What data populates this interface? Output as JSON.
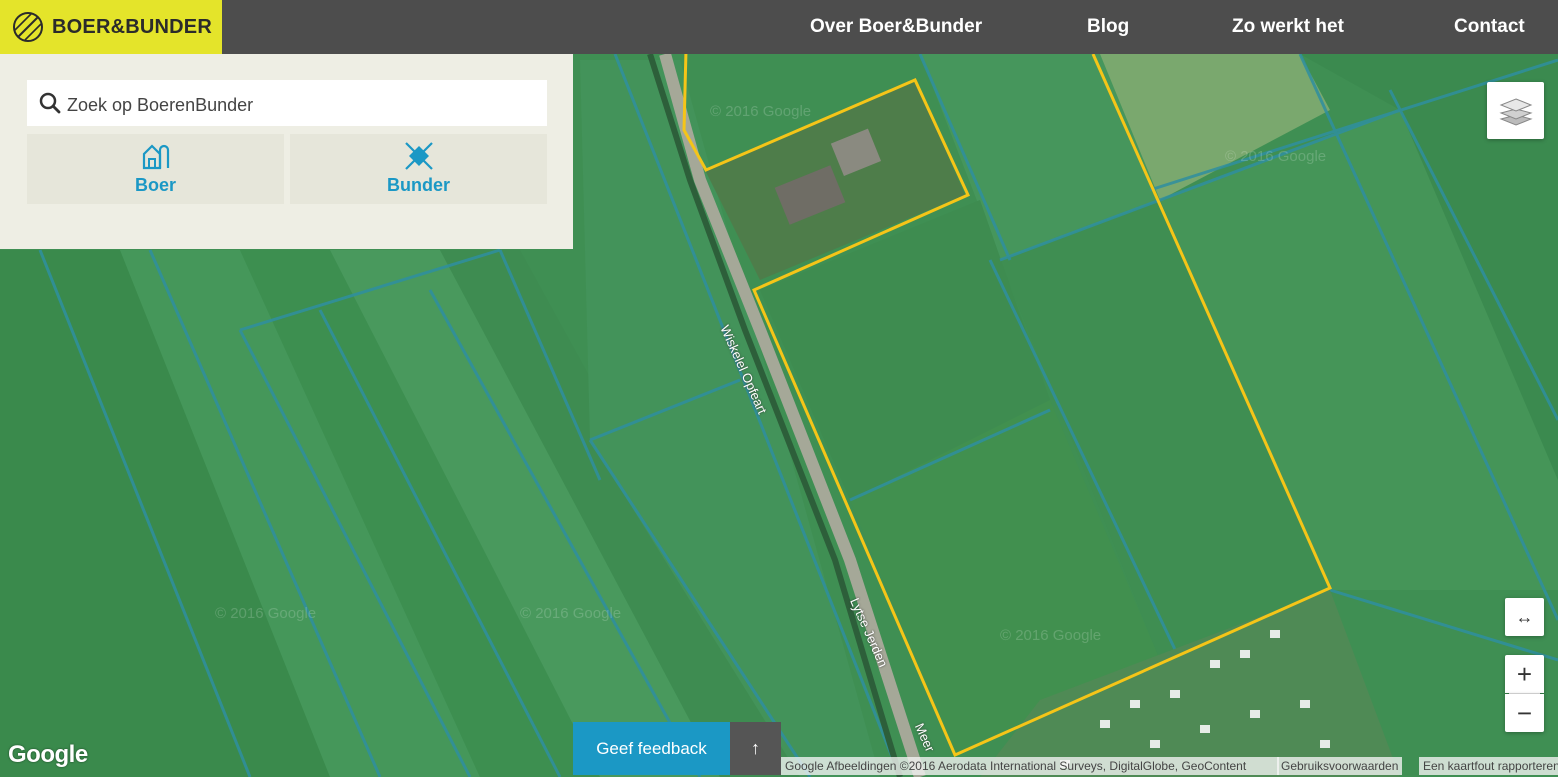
{
  "header": {
    "logo_text": "BOER&BUNDER",
    "nav": [
      "Over Boer&Bunder",
      "Blog",
      "Zo werkt het",
      "Contact"
    ]
  },
  "search": {
    "placeholder": "Zoek op BoerenBunder"
  },
  "buttons": {
    "boer": "Boer",
    "bunder": "Bunder"
  },
  "map": {
    "road_labels": [
      "Wiskelel Opfeart",
      "Lytse Jerden",
      "Meer"
    ],
    "watermark": "© 2016 Google",
    "google_logo": "Google",
    "attribution": "Google Afbeeldingen ©2016 Aerodata International Surveys, DigitalGlobe, GeoContent",
    "terms": "Gebruiksvoorwaarden",
    "report": "Een kaartfout rapporteren",
    "zoom_in": "+",
    "zoom_out": "−",
    "expand": "↔"
  },
  "feedback": {
    "label": "Geef feedback",
    "to_top": "↑"
  },
  "colors": {
    "logo_bg": "#e4e42a",
    "header_bg": "#4d4d4d",
    "accent": "#1b98c5",
    "parcel_outline": "#f5c518",
    "panel_bg": "#eeeee4"
  }
}
